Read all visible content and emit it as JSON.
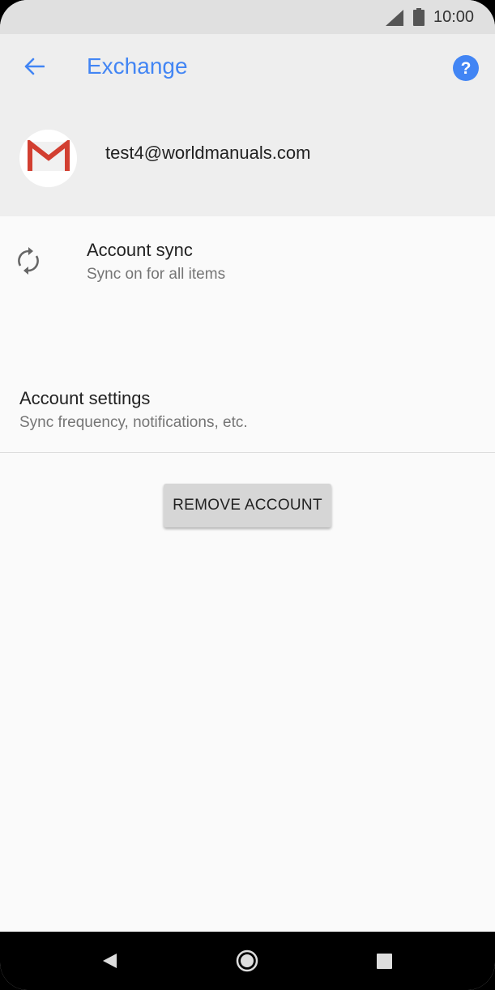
{
  "status_bar": {
    "time": "10:00",
    "icons": [
      "signal-icon",
      "battery-icon"
    ]
  },
  "header": {
    "title": "Exchange",
    "back_icon": "arrow-back-icon",
    "help_icon": "help-icon",
    "account_email": "test4@worldmanuals.com",
    "avatar_icon": "gmail-icon"
  },
  "items": [
    {
      "title": "Account sync",
      "subtitle": "Sync on for all items",
      "icon": "sync-icon"
    },
    {
      "title": "Account settings",
      "subtitle": "Sync frequency, notifications, etc."
    }
  ],
  "actions": {
    "remove_account": "REMOVE ACCOUNT"
  },
  "nav_bar": {
    "buttons": [
      "back-icon",
      "home-icon",
      "recents-icon"
    ]
  },
  "colors": {
    "accent": "#4285f4",
    "header_bg": "#eeeeee",
    "background": "#fafafa",
    "gmail_red": "#d23f31"
  }
}
